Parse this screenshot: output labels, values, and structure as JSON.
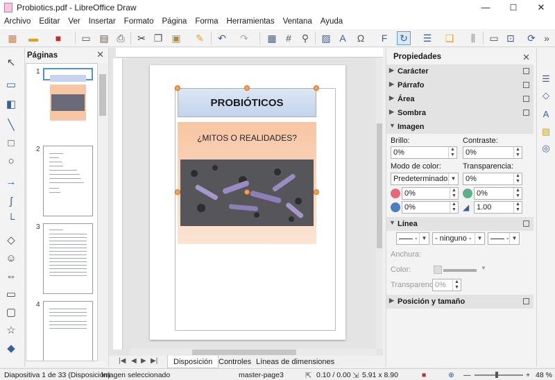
{
  "window": {
    "title": "Probiotics.pdf - LibreOffice Draw",
    "minimize": "—",
    "maximize": "☐",
    "close": "✕"
  },
  "menu": [
    "Archivo",
    "Editar",
    "Ver",
    "Insertar",
    "Formato",
    "Página",
    "Forma",
    "Herramientas",
    "Ventana",
    "Ayuda"
  ],
  "pages_panel": {
    "title": "Páginas",
    "pages": [
      "1",
      "2",
      "3",
      "4"
    ]
  },
  "document": {
    "title": "PROBIÓTICOS",
    "subtitle": "¿MITOS O REALIDADES?"
  },
  "tabs": [
    "Disposición",
    "Controles",
    "Líneas de dimensiones"
  ],
  "properties": {
    "title": "Propiedades",
    "sections": {
      "caracter": "Carácter",
      "parrafo": "Párrafo",
      "area": "Área",
      "sombra": "Sombra",
      "imagen": "Imagen",
      "linea": "Línea",
      "posicion": "Posición y tamaño"
    },
    "imagen": {
      "brillo_label": "Brillo:",
      "brillo_value": "0%",
      "contraste_label": "Contraste:",
      "contraste_value": "0%",
      "modo_label": "Modo de color:",
      "modo_value": "Predeterminado",
      "transparencia_label": "Transparencia:",
      "transparencia_value": "0%",
      "red_value": "0%",
      "green_value": "0%",
      "blue_value": "0%",
      "gamma_value": "1.00"
    },
    "linea": {
      "arrow_value": "- ninguno -",
      "anchura_label": "Anchura:",
      "color_label": "Color:",
      "transparencia_label": "Transparencia:",
      "transparencia_value": "0%"
    }
  },
  "status": {
    "slide": "Diapositiva 1 de 33 (Disposición)",
    "selection": "Imagen seleccionado",
    "master": "master-page3",
    "position": "0.10 / 0.00",
    "size": "5.91 x 8.90",
    "zoom": "48 %"
  },
  "colors": {
    "accent": "#4d8fd0",
    "title_gradient": "#c2d3ec",
    "orange_bg": "#f7c6a4"
  }
}
